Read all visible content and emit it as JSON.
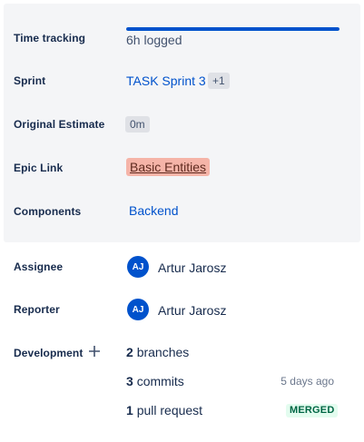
{
  "fields": {
    "time_tracking": {
      "label": "Time tracking",
      "value": "6h logged",
      "progress": 1.0
    },
    "sprint": {
      "label": "Sprint",
      "value": "TASK Sprint 3",
      "extra": "+1"
    },
    "original_estimate": {
      "label": "Original Estimate",
      "value": "0m"
    },
    "epic_link": {
      "label": "Epic Link",
      "value": "Basic Entities",
      "color": "#f5b4a8"
    },
    "components": {
      "label": "Components",
      "value": "Backend"
    },
    "assignee": {
      "label": "Assignee",
      "initials": "AJ",
      "name": "Artur Jarosz"
    },
    "reporter": {
      "label": "Reporter",
      "initials": "AJ",
      "name": "Artur Jarosz"
    }
  },
  "development": {
    "label": "Development",
    "add_icon": "plus-icon",
    "branches": {
      "count": "2",
      "text": "branches"
    },
    "commits": {
      "count": "3",
      "text": "commits",
      "time": "5 days ago"
    },
    "pull_requests": {
      "count": "1",
      "text": "pull request",
      "status": "MERGED"
    }
  },
  "colors": {
    "accent": "#0052cc",
    "panel_bg": "#f4f5f7",
    "merged_green": "#006644"
  }
}
